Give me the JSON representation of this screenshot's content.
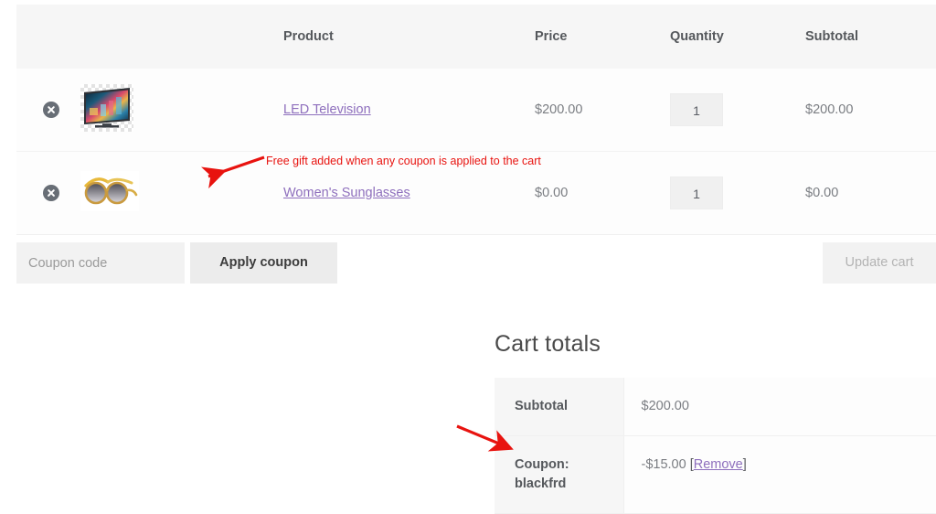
{
  "cart_table": {
    "headers": [
      "",
      "",
      "Product",
      "Price",
      "Quantity",
      "Subtotal"
    ],
    "header_product": "Product",
    "header_price": "Price",
    "header_quantity": "Quantity",
    "header_subtotal": "Subtotal",
    "rows": [
      {
        "remove_icon": "remove-circle-x-icon",
        "thumbnail": "led-television-thumbnail",
        "name": "LED Television",
        "price": "$200.00",
        "quantity": "1",
        "subtotal": "$200.00"
      },
      {
        "remove_icon": "remove-circle-x-icon",
        "thumbnail": "womens-sunglasses-thumbnail",
        "name": "Women's Sunglasses",
        "price": "$0.00",
        "quantity": "1",
        "subtotal": "$0.00"
      }
    ]
  },
  "actions": {
    "coupon_placeholder": "Coupon code",
    "coupon_value": "",
    "apply_coupon_label": "Apply coupon",
    "update_cart_label": "Update cart"
  },
  "cart_totals": {
    "title": "Cart totals",
    "rows": [
      {
        "label": "Subtotal",
        "value": "$200.00"
      },
      {
        "label": "Coupon: blackfrd",
        "amount": "-$15.00",
        "bracket_open": "[",
        "remove_link": "Remove",
        "bracket_close": "]"
      }
    ]
  },
  "annotations": [
    {
      "text": "Free gift added when any coupon is applied to the cart",
      "color": "#e8130f",
      "arrow": "arrow-pointing-left-to-sunglasses-thumbnail"
    },
    {
      "text": "",
      "color": "#e8130f",
      "arrow": "arrow-pointing-right-to-coupon-row"
    }
  ],
  "colors": {
    "link_purple": "#8e6fbd",
    "annotation_red": "#e8130f",
    "header_bg": "#f6f6f6",
    "remove_icon_gray": "#686e76"
  }
}
